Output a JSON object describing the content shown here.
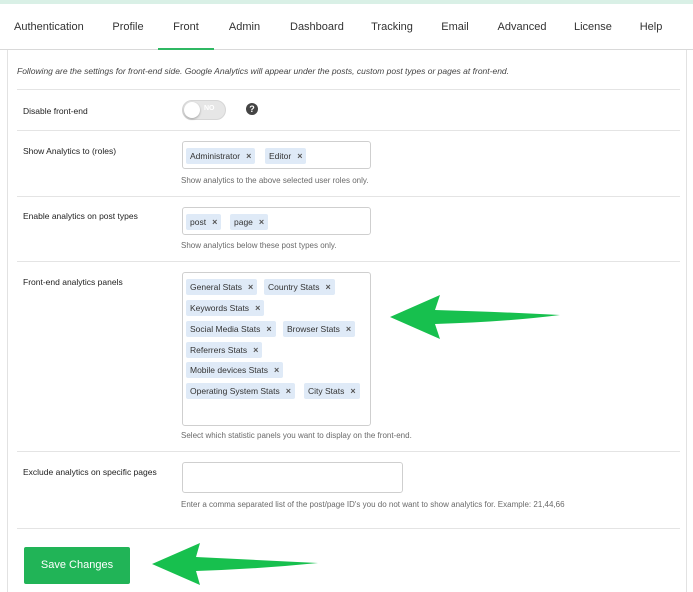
{
  "tabs": [
    "Authentication",
    "Profile",
    "Front",
    "Admin",
    "Dashboard",
    "Tracking",
    "Email",
    "Advanced",
    "License",
    "Help"
  ],
  "active_tab": "Front",
  "description": "Following are the settings for front-end side. Google Analytics will appear under the posts, custom post types or pages at front-end.",
  "settings": {
    "disable_frontend": {
      "label": "Disable front-end",
      "toggle_text": "NO",
      "help_icon": "question-circle-icon"
    },
    "show_roles": {
      "label": "Show Analytics to (roles)",
      "tags": [
        "Administrator",
        "Editor"
      ],
      "hint": "Show analytics to the above selected user roles only."
    },
    "post_types": {
      "label": "Enable analytics on post types",
      "tags": [
        "post",
        "page"
      ],
      "hint": "Show analytics below these post types only."
    },
    "panels": {
      "label": "Front-end analytics panels",
      "tags": [
        "General Stats",
        "Country Stats",
        "Keywords Stats",
        "Social Media Stats",
        "Browser Stats",
        "Referrers Stats",
        "Mobile devices Stats",
        "Operating System Stats",
        "City Stats"
      ],
      "hint": "Select which statistic panels you want to display on the front-end."
    },
    "exclude_pages": {
      "label": "Exclude analytics on specific pages",
      "value": "",
      "hint": "Enter a comma separated list of the post/page ID's you do not want to show analytics for. Example: 21,44,66"
    }
  },
  "save_label": "Save Changes",
  "tag_remove_glyph": "×",
  "colors": {
    "accent": "#21b457",
    "tag_bg": "#dfeaf7",
    "arrow": "#17c04e"
  }
}
